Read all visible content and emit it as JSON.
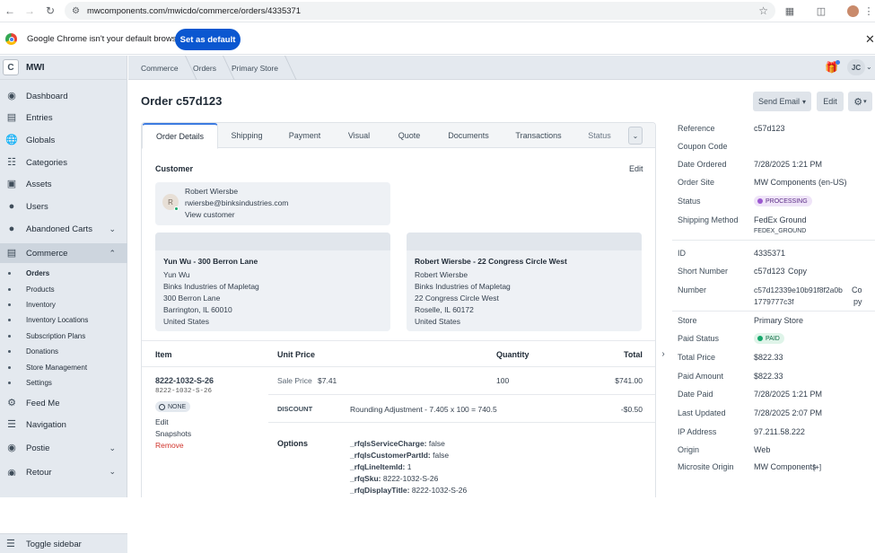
{
  "browser": {
    "url": "mwcomponents.com/mwicdo/commerce/orders/4335371",
    "info_text": "Google Chrome isn't your default browser",
    "set_default_label": "Set as default"
  },
  "sidebar": {
    "site_initial": "C",
    "site_name": "MWI",
    "items": [
      {
        "label": "Dashboard",
        "icon": "dashboard-icon"
      },
      {
        "label": "Entries",
        "icon": "entries-icon"
      },
      {
        "label": "Globals",
        "icon": "globe-icon"
      },
      {
        "label": "Categories",
        "icon": "categories-icon"
      },
      {
        "label": "Assets",
        "icon": "image-icon"
      },
      {
        "label": "Users",
        "icon": "users-icon"
      },
      {
        "label": "Abandoned Carts",
        "icon": "users-icon"
      },
      {
        "label": "Commerce",
        "icon": "commerce-icon"
      }
    ],
    "commerce_sub": [
      "Orders",
      "Products",
      "Inventory",
      "Inventory Locations",
      "Subscription Plans",
      "Donations",
      "Store Management",
      "Settings"
    ],
    "items_after": [
      {
        "label": "Feed Me",
        "icon": "feed-icon"
      },
      {
        "label": "Navigation",
        "icon": "menu-icon"
      },
      {
        "label": "Postie",
        "icon": "postie-icon"
      },
      {
        "label": "Retour",
        "icon": "retour-icon"
      }
    ],
    "toggle_label": "Toggle sidebar"
  },
  "breadcrumbs": [
    "Commerce",
    "Orders",
    "Primary Store"
  ],
  "user_initials": "JC",
  "page": {
    "title": "Order c57d123",
    "send_email_label": "Send Email",
    "edit_label": "Edit"
  },
  "tabs": [
    "Order Details",
    "Shipping",
    "Payment",
    "Visual",
    "Quote",
    "Documents",
    "Transactions",
    "Status"
  ],
  "customer": {
    "heading": "Customer",
    "edit_label": "Edit",
    "avatar_initial": "R",
    "name": "Robert Wiersbe",
    "email": "rwiersbe@binksindustries.com",
    "view_label": "View customer"
  },
  "addresses": [
    {
      "title": "Yun Wu - 300 Berron Lane",
      "lines": [
        "Yun Wu",
        "Binks Industries of Mapletag",
        "300 Berron Lane",
        "Barrington, IL 60010",
        "United States"
      ]
    },
    {
      "title": "Robert Wiersbe - 22 Congress Circle West",
      "lines": [
        "Robert Wiersbe",
        "Binks Industries of Mapletag",
        "22 Congress Circle West",
        "Roselle, IL 60172",
        "United States"
      ]
    }
  ],
  "line_items": {
    "headers": {
      "item": "Item",
      "unit_price": "Unit Price",
      "quantity": "Quantity",
      "total": "Total"
    },
    "sku": "8222-1032-S-26",
    "sku_sub": "8222-1032-S-26",
    "status_badge": "NONE",
    "actions": {
      "edit": "Edit",
      "snapshots": "Snapshots",
      "remove": "Remove"
    },
    "sale_price_label": "Sale Price",
    "sale_price": "$7.41",
    "quantity": "100",
    "line_total": "$741.00",
    "discount_label": "DISCOUNT",
    "discount_desc": "Rounding Adjustment - 7.405 x 100 = 740.5",
    "discount_amount": "-$0.50",
    "options_label": "Options",
    "options": [
      {
        "k": "_rfqIsServiceCharge:",
        "v": "false"
      },
      {
        "k": "_rfqIsCustomerPartId:",
        "v": "false"
      },
      {
        "k": "_rfqLineItemId:",
        "v": "1"
      },
      {
        "k": "_rfqSku:",
        "v": "8222-1032-S-26"
      },
      {
        "k": "_rfqDisplayTitle:",
        "v": "8222-1032-S-26"
      }
    ]
  },
  "meta": {
    "reference": {
      "k": "Reference",
      "v": "c57d123"
    },
    "coupon": {
      "k": "Coupon Code",
      "v": ""
    },
    "date_ordered": {
      "k": "Date Ordered",
      "v": "7/28/2025 1:21 PM"
    },
    "order_site": {
      "k": "Order Site",
      "v": "MW Components (en-US)"
    },
    "status": {
      "k": "Status",
      "v": "PROCESSING",
      "color": "#9b59d0"
    },
    "shipping_method": {
      "k": "Shipping Method",
      "v": "FedEx Ground",
      "sub": "FEDEX_GROUND"
    },
    "id": {
      "k": "ID",
      "v": "4335371"
    },
    "short_number": {
      "k": "Short Number",
      "v": "c57d123",
      "copy": "Copy"
    },
    "number": {
      "k": "Number",
      "v1": "c57d12339e10b91f8f2a0b",
      "v2": "1779777c3f",
      "copy1": "Co",
      "copy2": "py"
    },
    "store": {
      "k": "Store",
      "v": "Primary Store"
    },
    "paid_status": {
      "k": "Paid Status",
      "v": "PAID",
      "color": "#14a86b"
    },
    "total_price": {
      "k": "Total Price",
      "v": "$822.33"
    },
    "paid_amount": {
      "k": "Paid Amount",
      "v": "$822.33"
    },
    "date_paid": {
      "k": "Date Paid",
      "v": "7/28/2025 1:21 PM"
    },
    "last_updated": {
      "k": "Last Updated",
      "v": "7/28/2025 2:07 PM"
    },
    "ip": {
      "k": "IP Address",
      "v": "97.211.58.222"
    },
    "origin": {
      "k": "Origin",
      "v": "Web"
    },
    "microsite": {
      "k": "Microsite Origin",
      "v": "MW Components",
      "extra": "[+]"
    }
  }
}
